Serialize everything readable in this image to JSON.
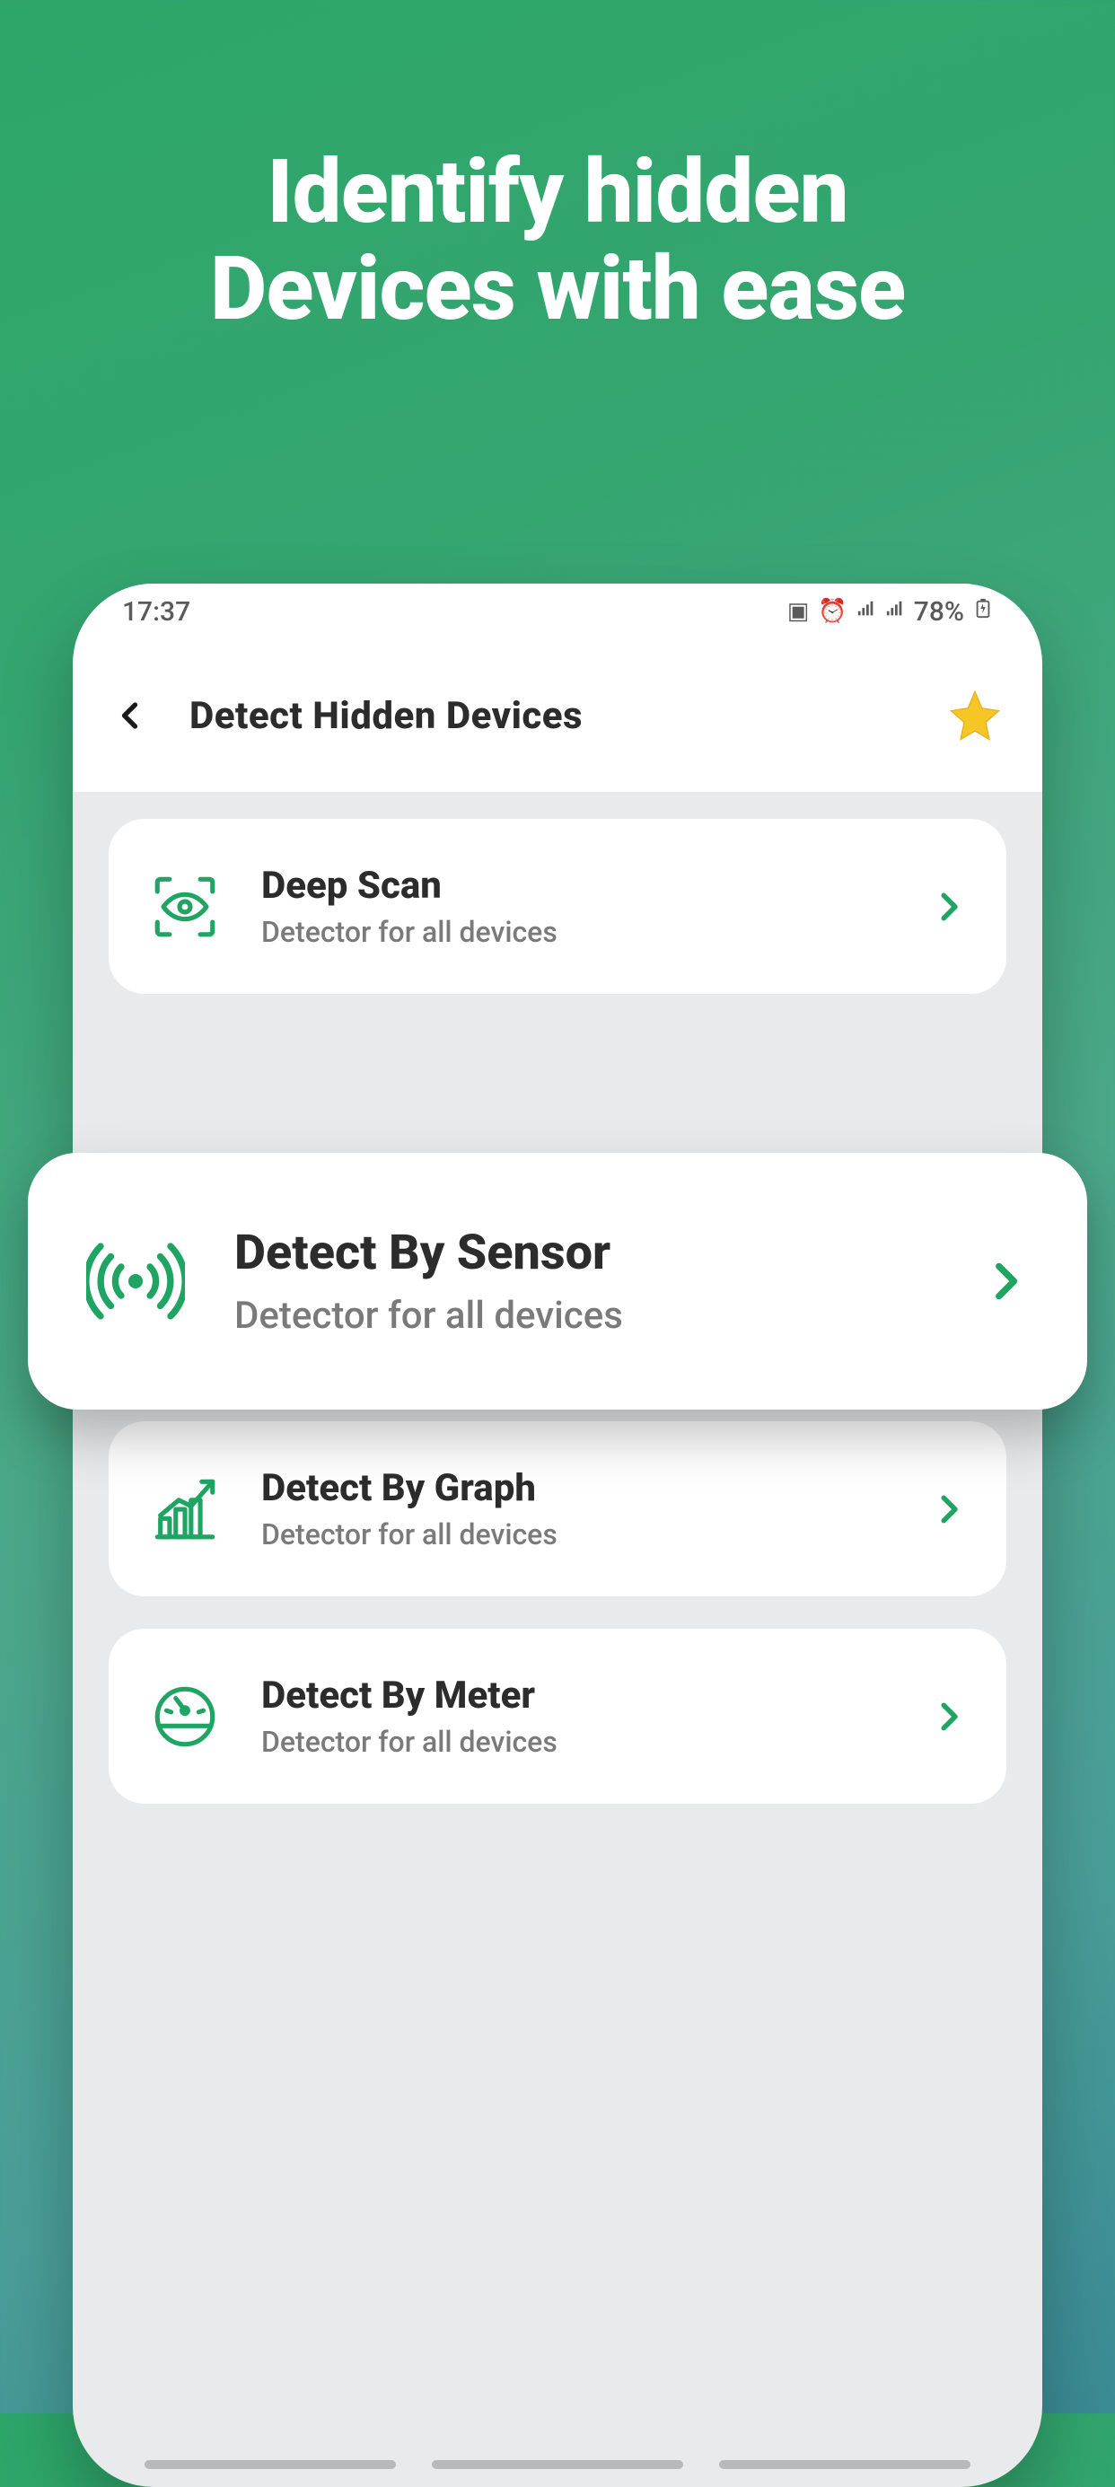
{
  "headline_line1": "Identify hidden",
  "headline_line2": "Devices with ease",
  "status": {
    "time": "17:37",
    "battery": "78%"
  },
  "header": {
    "title": "Detect Hidden Devices"
  },
  "colors": {
    "accent": "#1fa463"
  },
  "cards": [
    {
      "title": "Deep Scan",
      "sub": "Detector for all devices",
      "icon": "eye-scan-icon"
    },
    {
      "title": "Detect By Sensor",
      "sub": "Detector for all devices",
      "icon": "radio-waves-icon"
    },
    {
      "title": "Detect By Graph",
      "sub": "Detector for all devices",
      "icon": "growth-chart-icon"
    },
    {
      "title": "Detect By Meter",
      "sub": "Detector for all devices",
      "icon": "gauge-icon"
    }
  ]
}
